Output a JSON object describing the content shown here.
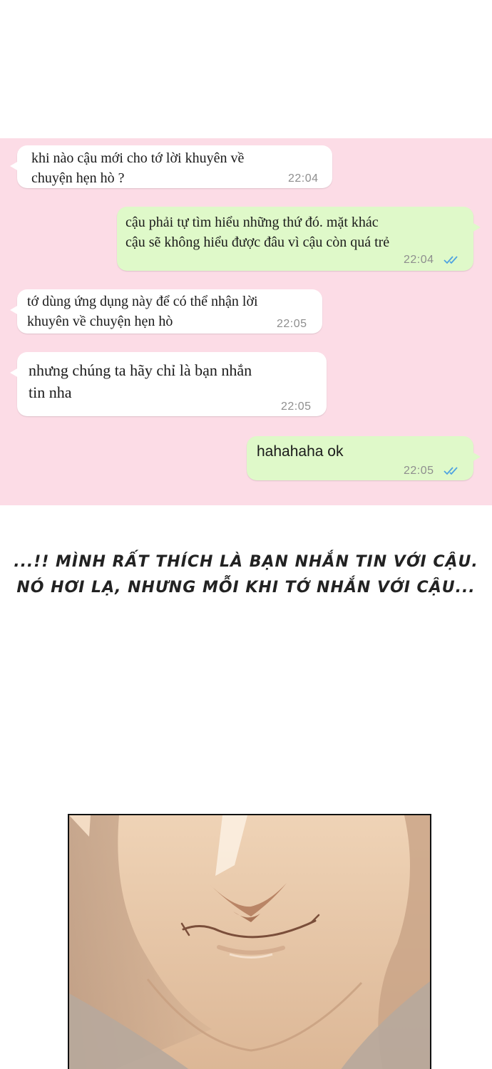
{
  "chat": {
    "background_color": "#fcdce6",
    "incoming_color": "#ffffff",
    "outgoing_color": "#dff9c9",
    "tick_color": "#4fa3e0",
    "messages": [
      {
        "direction": "in",
        "text": "khi nào cậu mới cho tớ lời khuyên về\nchuyện hẹn hò ?",
        "time": "22:04"
      },
      {
        "direction": "out",
        "text": "cậu phải tự tìm hiểu những thứ đó. mặt khác\ncậu sẽ không hiểu được đâu vì cậu còn quá trẻ",
        "time": "22:04",
        "status_icon": "double-check-icon"
      },
      {
        "direction": "in",
        "text": "tớ dùng ứng dụng này để có thể nhận lời\nkhuyên về chuyện hẹn hò",
        "time": "22:05"
      },
      {
        "direction": "in",
        "text": "nhưng chúng ta hãy chỉ là bạn nhắn\ntin nha",
        "time": "22:05"
      },
      {
        "direction": "out",
        "text": "hahahaha ok",
        "time": "22:05",
        "status_icon": "double-check-icon"
      }
    ]
  },
  "caption": {
    "line1": "...!! MÌNH RẤT THÍCH LÀ BẠN NHẮN TIN VỚI CẬU.",
    "line2": "NÓ HƠI LẠ, NHƯNG MỖI KHI TỚ NHẮN VỚI CẬU..."
  },
  "panel": {
    "subject": "close-up smiling face",
    "skin_color": "#e9c9aa",
    "border_color": "#111111"
  }
}
